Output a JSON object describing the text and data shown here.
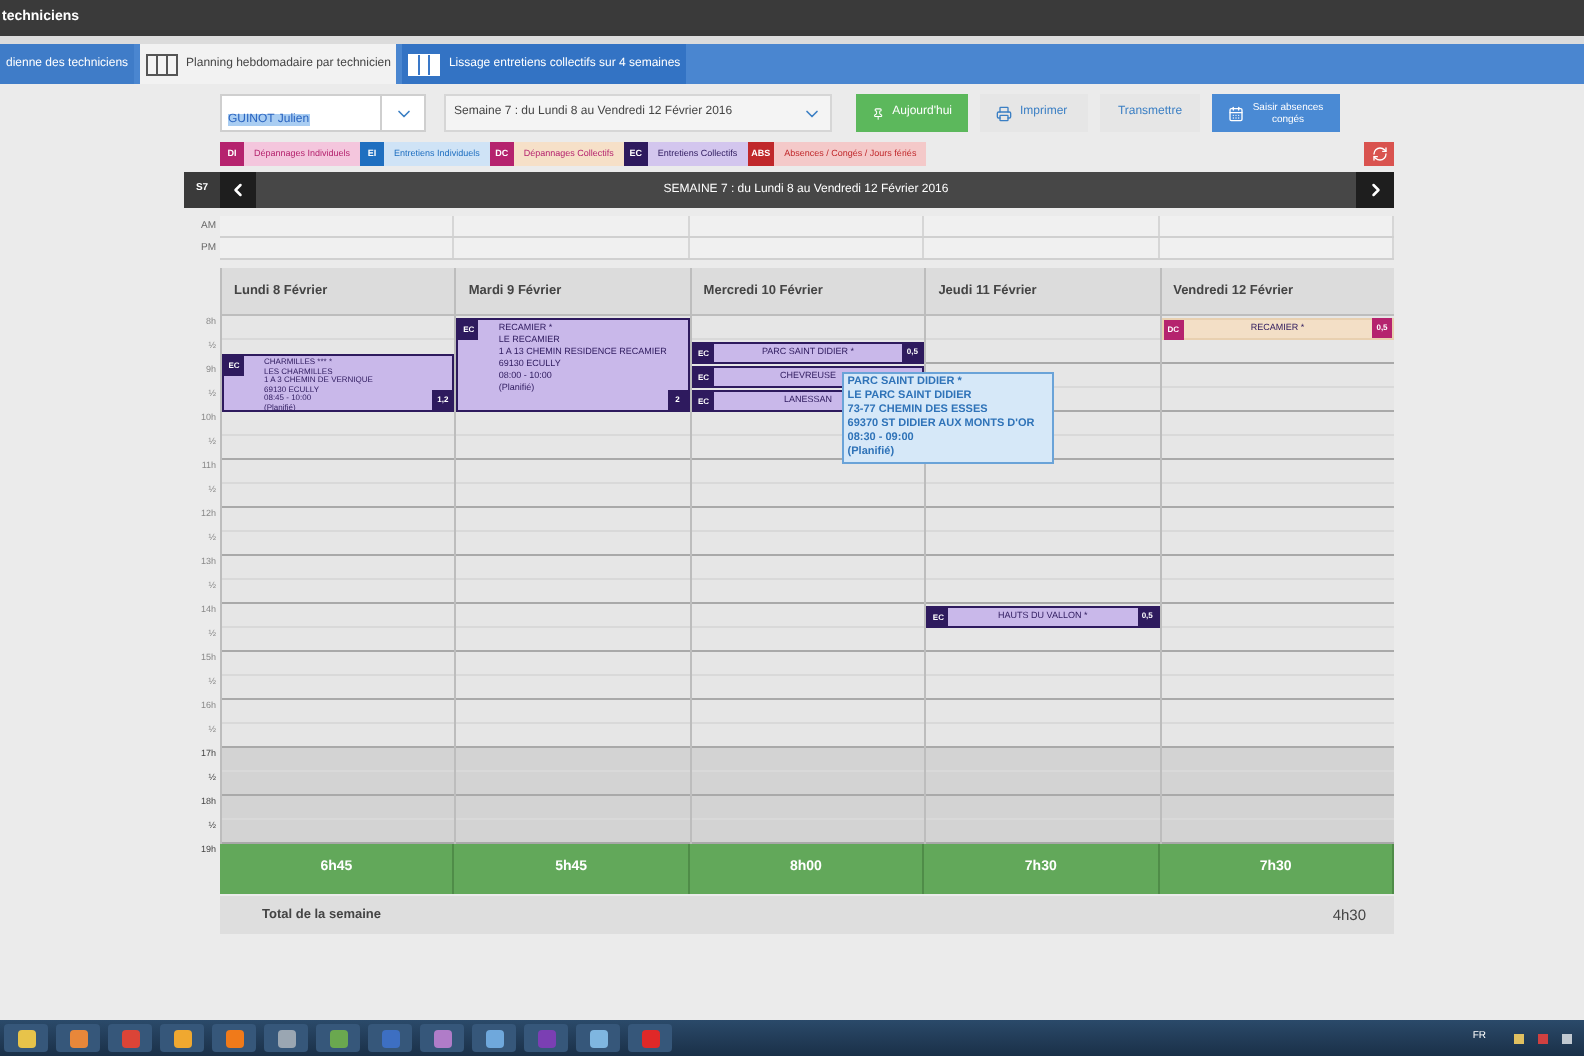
{
  "window": {
    "title": "techniciens"
  },
  "tabs": [
    {
      "label": "dienne des techniciens",
      "selected": false,
      "kind": "plain"
    },
    {
      "label": "Planning hebdomadaire par technicien",
      "selected": true,
      "kind": "columns"
    },
    {
      "label": "Lissage entretiens collectifs sur 4 semaines",
      "selected": false,
      "kind": "columns"
    }
  ],
  "toolbar": {
    "technician": "GUINOT Julien",
    "week": "Semaine 7 : du Lundi 8 au Vendredi 12 Février 2016",
    "buttons": [
      {
        "kind": "today",
        "label": "Aujourd'hui"
      },
      {
        "kind": "print",
        "label": "Imprimer"
      },
      {
        "kind": "plain",
        "label": "Transmettre"
      },
      {
        "kind": "absence",
        "label": "Saisir absences congés"
      }
    ]
  },
  "legend": [
    {
      "code": "DI",
      "label": "Dépannages Individuels",
      "color": "#b5236e",
      "kind": "di"
    },
    {
      "code": "EI",
      "label": "Entretiens Individuels",
      "color": "#1f6fc0",
      "kind": "ei"
    },
    {
      "code": "DC",
      "label": "Dépannages Collectifs",
      "color": "#b5236e",
      "kind": "dc"
    },
    {
      "code": "EC",
      "label": "Entretiens Collectifs",
      "color": "#2e1a5e",
      "kind": "ec"
    },
    {
      "code": "ABS",
      "label": "Absences / Congés / Jours fériés",
      "color": "#c0282b",
      "kind": "abs"
    }
  ],
  "week_bar": {
    "number": "S7",
    "title": "SEMAINE 7 : du Lundi 8 au Vendredi 12 Février 2016"
  },
  "periods": [
    "AM",
    "PM"
  ],
  "time_labels": [
    {
      "label": "8h",
      "off_hours": false
    },
    {
      "label": "½",
      "off_hours": false
    },
    {
      "label": "9h",
      "off_hours": false
    },
    {
      "label": "½",
      "off_hours": false
    },
    {
      "label": "10h",
      "off_hours": false
    },
    {
      "label": "½",
      "off_hours": false
    },
    {
      "label": "11h",
      "off_hours": false
    },
    {
      "label": "½",
      "off_hours": false
    },
    {
      "label": "12h",
      "off_hours": false
    },
    {
      "label": "½",
      "off_hours": false
    },
    {
      "label": "13h",
      "off_hours": false
    },
    {
      "label": "½",
      "off_hours": false
    },
    {
      "label": "14h",
      "off_hours": false
    },
    {
      "label": "½",
      "off_hours": false
    },
    {
      "label": "15h",
      "off_hours": false
    },
    {
      "label": "½",
      "off_hours": false
    },
    {
      "label": "16h",
      "off_hours": false
    },
    {
      "label": "½",
      "off_hours": false
    },
    {
      "label": "17h",
      "off_hours": true
    },
    {
      "label": "½",
      "off_hours": true
    },
    {
      "label": "18h",
      "off_hours": true
    },
    {
      "label": "½",
      "off_hours": true
    },
    {
      "label": "19h",
      "off_hours": true
    }
  ],
  "days": [
    {
      "title": "Lundi 8 Février",
      "total": "6h45",
      "events": [
        {
          "code": "EC",
          "color": "#2e1a5e",
          "kind": "ec",
          "lines": [
            "CHARMILLES *** *",
            "LES CHARMILLES",
            "1 A 3 CHEMIN DE VERNIQUE",
            "69130 ECULLY",
            "08:45 - 10:00",
            "(Planifié)"
          ],
          "count": "1,2"
        }
      ]
    },
    {
      "title": "Mardi 9 Février",
      "total": "5h45",
      "events": [
        {
          "code": "EC",
          "color": "#2e1a5e",
          "kind": "ec",
          "lines": [
            "RECAMIER *",
            "LE RECAMIER",
            "1 A 13 CHEMIN RESIDENCE RECAMIER",
            "69130 ECULLY",
            "08:00 - 10:00",
            "(Planifié)"
          ],
          "count": "2"
        }
      ]
    },
    {
      "title": "Mercredi 10 Février",
      "total": "8h00",
      "events": [
        {
          "code": "EC",
          "color": "#2e1a5e",
          "kind": "ec",
          "lines": [
            "PARC SAINT DIDIER *"
          ],
          "count": "0,5",
          "tooltip": [
            "PARC SAINT DIDIER *",
            "LE PARC SAINT DIDIER",
            "73-77 CHEMIN DES ESSES",
            "69370 ST DIDIER AUX MONTS D'OR",
            "08:30 - 09:00",
            "(Planifié)"
          ]
        },
        {
          "code": "EC",
          "color": "#2e1a5e",
          "kind": "ec",
          "lines": [
            "CHEVREUSE"
          ]
        },
        {
          "code": "EC",
          "color": "#2e1a5e",
          "kind": "ec",
          "lines": [
            "LANESSAN"
          ]
        }
      ]
    },
    {
      "title": "Jeudi 11 Février",
      "total": "7h30",
      "events": [
        {
          "code": "EC",
          "color": "#2e1a5e",
          "kind": "ec",
          "lines": [
            "HAUTS DU VALLON *"
          ],
          "count": "0,5"
        }
      ]
    },
    {
      "title": "Vendredi 12 Février",
      "total": "7h30",
      "events": [
        {
          "code": "DC",
          "color": "#b5236e",
          "kind": "dc",
          "lines": [
            "RECAMIER *"
          ],
          "count": "0,5"
        }
      ]
    }
  ],
  "week_total": {
    "label": "Total de la semaine",
    "value": "4h30"
  },
  "taskbar": {
    "language": "FR"
  }
}
